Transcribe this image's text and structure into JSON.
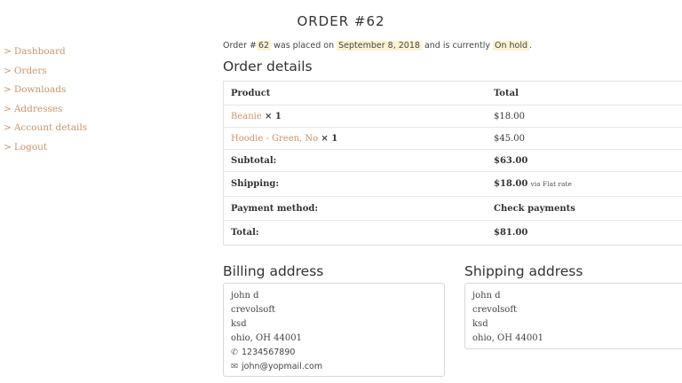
{
  "page": {
    "title": "ORDER #62"
  },
  "nav": {
    "items": [
      {
        "chevron": ">",
        "label": "Dashboard"
      },
      {
        "chevron": ">",
        "label": "Orders"
      },
      {
        "chevron": ">",
        "label": "Downloads"
      },
      {
        "chevron": ">",
        "label": "Addresses"
      },
      {
        "chevron": ">",
        "label": "Account details"
      },
      {
        "chevron": ">",
        "label": "Logout"
      }
    ]
  },
  "intro": {
    "prefix": "Order #",
    "order_number": "62",
    "mid1": " was placed on ",
    "date": "September 8, 2018",
    "mid2": " and is currently ",
    "status": "On hold",
    "suffix": "."
  },
  "order_details": {
    "heading": "Order details",
    "header": {
      "product": "Product",
      "total": "Total"
    },
    "items": [
      {
        "name": "Beanie",
        "qty": "× 1",
        "total": "$18.00"
      },
      {
        "name": "Hoodie - Green, No",
        "qty": "× 1",
        "total": "$45.00"
      }
    ],
    "subtotal": {
      "label": "Subtotal:",
      "value": "$63.00"
    },
    "shipping": {
      "label": "Shipping:",
      "value": "$18.00",
      "note": "via Flat rate"
    },
    "payment": {
      "label": "Payment method:",
      "value": "Check payments"
    },
    "total": {
      "label": "Total:",
      "value": "$81.00"
    }
  },
  "billing": {
    "heading": "Billing address",
    "lines": [
      "john d",
      "crevolsoft",
      "ksd",
      "ohio, OH 44001"
    ],
    "phone": "1234567890",
    "email": "john@yopmail.com"
  },
  "shipping_address": {
    "heading": "Shipping address",
    "lines": [
      "john d",
      "crevolsoft",
      "ksd",
      "ohio, OH 44001"
    ]
  },
  "colors": {
    "accent": "#c9956a",
    "highlight": "#fcf2d2"
  },
  "icons": {
    "phone": "phone-icon",
    "email": "email-icon"
  }
}
